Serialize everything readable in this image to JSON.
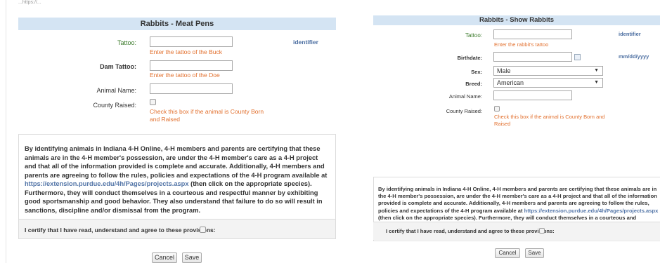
{
  "top_url": "...https://...",
  "meat": {
    "title": "Rabbits - Meat Pens",
    "tattoo": {
      "label": "Tattoo:",
      "hint": "Enter the tattoo of the Buck",
      "side": "identifier"
    },
    "dam_tattoo": {
      "label": "Dam Tattoo:",
      "hint": "Enter the tattoo of the Doe"
    },
    "animal_name": {
      "label": "Animal Name:"
    },
    "county_raised": {
      "label": "County Raised:",
      "hint": "Check this box if the animal is County Born and Raised"
    },
    "terms": {
      "text_a": "By identifying animals in Indiana 4-H Online, 4-H members and parents are certifying that these animals are in the 4-H member's possession, are under the 4-H member's care as a 4-H project and that all of the information provided is complete and accurate. Additionally, 4-H members and parents are agreeing to follow the rules, policies and expectations of the 4-H program available at ",
      "link": "https://extension.purdue.edu/4h/Pages/projects.aspx",
      "text_b": " (then click on the appropriate species). Furthermore, they will conduct themselves in a courteous and respectful manner by exhibiting good sportsmanship and good behavior. They also understand that failure to do so will result in sanctions, discipline and/or dismissal from the program."
    },
    "certify": "I certify that I have read, understand and agree to these provisions:",
    "cancel": "Cancel",
    "save": "Save"
  },
  "show": {
    "title": "Rabbits - Show Rabbits",
    "tattoo": {
      "label": "Tattoo:",
      "hint": "Enter the rabbit's tattoo",
      "side": "identifier"
    },
    "birthdate": {
      "label": "Birthdate:",
      "side": "mm/dd/yyyy"
    },
    "sex": {
      "label": "Sex:",
      "value": "Male"
    },
    "breed": {
      "label": "Breed:",
      "value": "American"
    },
    "animal_name": {
      "label": "Animal Name:"
    },
    "county_raised": {
      "label": "County Raised:",
      "hint": "Check this box if the animal is County Born and Raised"
    },
    "terms": {
      "text_a": "By identifying animals in Indiana 4-H Online, 4-H members and parents are certifying that these animals are in the 4-H member's possession, are under the 4-H member's care as a 4-H project and that all of the information provided is complete and accurate. Additionally, 4-H members and parents are agreeing to follow the rules, policies and expectations of the 4-H program available at ",
      "link": "https://extension.purdue.edu/4h/Pages/projects.aspx",
      "text_b": " (then click on the appropriate species). Furthermore, they will conduct themselves in a courteous and respectful manner by exhibiting good sportsmanship and good behavior. They also understand that failure to do so will result in sanctions, discipline and/or dismissal from the program."
    },
    "certify": "I certify that I have read, understand and agree to these provisions:",
    "cancel": "Cancel",
    "save": "Save"
  }
}
